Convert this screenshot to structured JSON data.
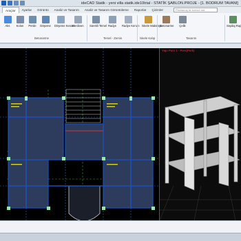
{
  "window": {
    "title": "ideCAD Statik - yeni villa statik.ide10trial - STATİK ŞABLON.PROJE - [1. BODRUM TAVANI]"
  },
  "tabs": [
    "Araçlar",
    "Ayarlar",
    "Görüntü",
    "Analiz ve Tasarım",
    "Analiz ve Tasarım Görüntüleme",
    "Raporlar",
    "Çizimler"
  ],
  "active_tab_index": 0,
  "search": {
    "placeholder": "Planlamaj ile konsol ara"
  },
  "ribbon": {
    "buttons": [
      "Aks",
      "Kolon",
      "Perde",
      "Döşeme",
      "Döşeme Kenarı",
      "Merdiven",
      "Sürekli Temel",
      "Radye",
      "Radye Kenarı",
      "İskele Maksisyu",
      "Betonarme",
      "Çelik",
      "Sepilaj Raporları"
    ],
    "groups": [
      "Betonarme",
      "Temel - Zemin",
      "İskele Kalıp",
      "Tasarım"
    ]
  },
  "view3d": {
    "title": "Yapı Pers 1 - Pers(Perk)"
  },
  "colors": {
    "plan_bg": "#000000",
    "beam": "#1c4fbf",
    "slab": "#2d3c5c",
    "grid_dashed": "#2c9b39",
    "column": "#9fe3b3",
    "label": "#d4cf26"
  }
}
